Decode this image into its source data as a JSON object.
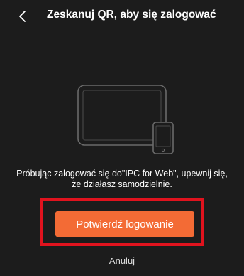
{
  "header": {
    "back_icon": "chevron-left-icon",
    "title": "Zeskanuj QR, aby się zalogować"
  },
  "illustration": {
    "icon": "tablet-and-phone-icon"
  },
  "message": {
    "line1": "Próbując zalogować się do\"IPC for Web\", upewnij się,",
    "line2": "że działasz samodzielnie."
  },
  "actions": {
    "confirm_label": "Potwierdź logowanie",
    "cancel_label": "Anuluj"
  },
  "colors": {
    "background": "#1c1c1c",
    "accent": "#f36b35",
    "highlight": "#e0131e",
    "text": "#ffffff"
  }
}
